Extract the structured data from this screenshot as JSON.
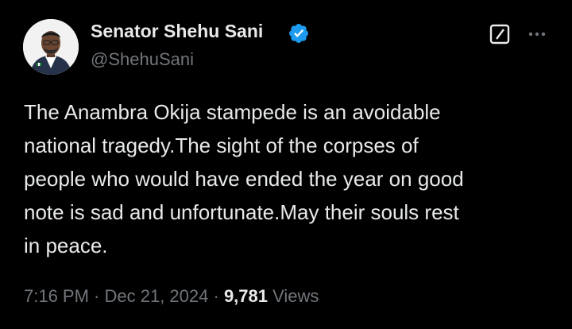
{
  "author": {
    "name": "Senator Shehu Sani",
    "handle": "@ShehuSani",
    "verified_color": "#1d9bf0"
  },
  "icons": {
    "verified": "verified-badge-icon",
    "grok": "grok-icon",
    "more": "more-options-icon"
  },
  "tweet": {
    "lines": [
      "The Anambra Okija stampede is an avoidable",
      "national tragedy.The sight of the corpses of",
      "people who would have ended the year on good",
      "note is sad and unfortunate.May their souls rest",
      "in peace."
    ]
  },
  "meta": {
    "time": "7:16 PM",
    "separator": " · ",
    "date": "Dec 21, 2024",
    "views_count": "9,781",
    "views_label": "Views"
  },
  "colors": {
    "background": "#000000",
    "primary_text": "#e7e9ea",
    "secondary_text": "#71767b",
    "accent": "#1d9bf0"
  }
}
